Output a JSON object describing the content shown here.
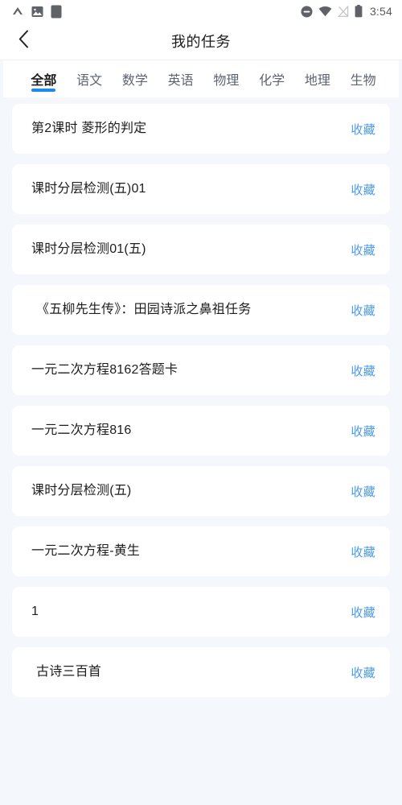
{
  "status_bar": {
    "icons_left": [
      "arrow-up-icon",
      "image-icon",
      "document-icon"
    ],
    "icons_right": [
      "do-not-disturb-icon",
      "wifi-icon",
      "signal-off-icon",
      "battery-icon"
    ],
    "time": "3:54"
  },
  "header": {
    "back_icon": "back-chevron-icon",
    "title": "我的任务"
  },
  "tabs": {
    "active_index": 0,
    "underline_color": "#1b8af0",
    "items": [
      {
        "label": "全部"
      },
      {
        "label": "语文"
      },
      {
        "label": "数学"
      },
      {
        "label": "英语"
      },
      {
        "label": "物理"
      },
      {
        "label": "化学"
      },
      {
        "label": "地理"
      },
      {
        "label": "生物"
      }
    ]
  },
  "list": {
    "favorite_label": "收藏",
    "favorite_color": "#4a9af0",
    "items": [
      {
        "title": "第2课时 菱形的判定",
        "favorite": "收藏",
        "indented": false
      },
      {
        "title": "课时分层检测(五)01",
        "favorite": "收藏",
        "indented": false
      },
      {
        "title": "课时分层检测01(五)",
        "favorite": "收藏",
        "indented": false
      },
      {
        "title": "《五柳先生传》：田园诗派之鼻祖任务",
        "favorite": "收藏",
        "indented": true
      },
      {
        "title": "一元二次方程8162答题卡",
        "favorite": "收藏",
        "indented": false
      },
      {
        "title": "一元二次方程816",
        "favorite": "收藏",
        "indented": false
      },
      {
        "title": "课时分层检测(五)",
        "favorite": "收藏",
        "indented": false
      },
      {
        "title": "一元二次方程-黄生",
        "favorite": "收藏",
        "indented": false
      },
      {
        "title": "1",
        "favorite": "收藏",
        "indented": false
      },
      {
        "title": "古诗三百首",
        "favorite": "收藏",
        "indented": true
      }
    ]
  },
  "colors": {
    "page_background": "#f4f7fb",
    "card_background": "#ffffff",
    "accent": "#1b8af0",
    "text_primary": "#1d1d1d",
    "text_secondary": "#5d6470"
  }
}
